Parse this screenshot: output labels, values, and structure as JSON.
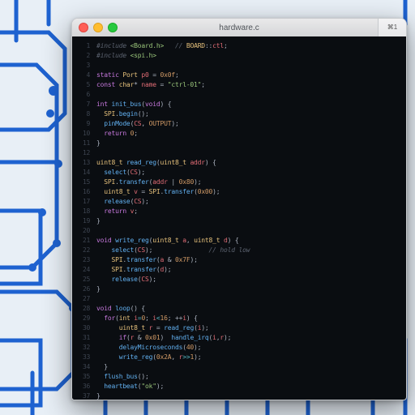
{
  "window": {
    "title": "hardware.c",
    "corner_tag": "⌘1"
  },
  "traffic": {
    "close": "close",
    "minimize": "minimize",
    "zoom": "zoom"
  },
  "editor": {
    "line_start": 1,
    "lines": [
      [
        [
          "c-c",
          "#include "
        ],
        [
          "c-s",
          "<Board.h>"
        ],
        [
          "c-p",
          "   "
        ],
        [
          "c-c",
          "// "
        ],
        [
          "c-f",
          "BOARD"
        ],
        [
          "c-p",
          "::"
        ],
        [
          "c-v",
          "ctl"
        ],
        [
          "c-p",
          ";"
        ]
      ],
      [
        [
          "c-c",
          "#include "
        ],
        [
          "c-s",
          "<spi.h>"
        ]
      ],
      [
        [
          "c-p",
          ""
        ]
      ],
      [
        [
          "c-k",
          "static "
        ],
        [
          "c-f",
          "Port"
        ],
        [
          "c-p",
          " "
        ],
        [
          "c-v",
          "p0"
        ],
        [
          "c-p",
          " = "
        ],
        [
          "c-n",
          "0x0f"
        ],
        [
          "c-p",
          ";"
        ]
      ],
      [
        [
          "c-k",
          "const "
        ],
        [
          "c-f",
          "char"
        ],
        [
          "c-p",
          "* "
        ],
        [
          "c-v",
          "name"
        ],
        [
          "c-p",
          " = "
        ],
        [
          "c-s",
          "\"ctrl-01\""
        ],
        [
          "c-p",
          ";"
        ]
      ],
      [
        [
          "c-p",
          ""
        ]
      ],
      [
        [
          "c-k",
          "int "
        ],
        [
          "c-b",
          "init_bus"
        ],
        [
          "c-p",
          "("
        ],
        [
          "c-k",
          "void"
        ],
        [
          "c-p",
          ") {"
        ]
      ],
      [
        [
          "c-p",
          "  "
        ],
        [
          "c-f",
          "SPI"
        ],
        [
          "c-p",
          "."
        ],
        [
          "c-b",
          "begin"
        ],
        [
          "c-p",
          "();"
        ]
      ],
      [
        [
          "c-p",
          "  "
        ],
        [
          "c-b",
          "pinMode"
        ],
        [
          "c-p",
          "("
        ],
        [
          "c-v",
          "CS"
        ],
        [
          "c-p",
          ", "
        ],
        [
          "c-n",
          "OUTPUT"
        ],
        [
          "c-p",
          ");"
        ]
      ],
      [
        [
          "c-p",
          "  "
        ],
        [
          "c-k",
          "return "
        ],
        [
          "c-n",
          "0"
        ],
        [
          "c-p",
          ";"
        ]
      ],
      [
        [
          "c-p",
          "}"
        ]
      ],
      [
        [
          "c-p",
          ""
        ]
      ],
      [
        [
          "c-f",
          "uint8_t "
        ],
        [
          "c-b",
          "read_reg"
        ],
        [
          "c-p",
          "("
        ],
        [
          "c-f",
          "uint8_t "
        ],
        [
          "c-v",
          "addr"
        ],
        [
          "c-p",
          ") {"
        ]
      ],
      [
        [
          "c-p",
          "  "
        ],
        [
          "c-b",
          "select"
        ],
        [
          "c-p",
          "("
        ],
        [
          "c-v",
          "CS"
        ],
        [
          "c-p",
          ");"
        ]
      ],
      [
        [
          "c-p",
          "  "
        ],
        [
          "c-f",
          "SPI"
        ],
        [
          "c-p",
          "."
        ],
        [
          "c-b",
          "transfer"
        ],
        [
          "c-p",
          "("
        ],
        [
          "c-v",
          "addr"
        ],
        [
          "c-p",
          " | "
        ],
        [
          "c-n",
          "0x80"
        ],
        [
          "c-p",
          ");"
        ]
      ],
      [
        [
          "c-p",
          "  "
        ],
        [
          "c-f",
          "uint8_t "
        ],
        [
          "c-v",
          "v"
        ],
        [
          "c-p",
          " = "
        ],
        [
          "c-f",
          "SPI"
        ],
        [
          "c-p",
          "."
        ],
        [
          "c-b",
          "transfer"
        ],
        [
          "c-p",
          "("
        ],
        [
          "c-n",
          "0x00"
        ],
        [
          "c-p",
          ");"
        ]
      ],
      [
        [
          "c-p",
          "  "
        ],
        [
          "c-b",
          "release"
        ],
        [
          "c-p",
          "("
        ],
        [
          "c-v",
          "CS"
        ],
        [
          "c-p",
          ");"
        ]
      ],
      [
        [
          "c-p",
          "  "
        ],
        [
          "c-k",
          "return "
        ],
        [
          "c-v",
          "v"
        ],
        [
          "c-p",
          ";"
        ]
      ],
      [
        [
          "c-p",
          "}"
        ]
      ],
      [
        [
          "c-p",
          ""
        ]
      ],
      [
        [
          "c-k",
          "void "
        ],
        [
          "c-b",
          "write_reg"
        ],
        [
          "c-p",
          "("
        ],
        [
          "c-f",
          "uint8_t "
        ],
        [
          "c-v",
          "a"
        ],
        [
          "c-p",
          ", "
        ],
        [
          "c-f",
          "uint8_t "
        ],
        [
          "c-v",
          "d"
        ],
        [
          "c-p",
          ") {"
        ]
      ],
      [
        [
          "c-p",
          "    "
        ],
        [
          "c-b",
          "select"
        ],
        [
          "c-p",
          "("
        ],
        [
          "c-v",
          "CS"
        ],
        [
          "c-p",
          ");               "
        ],
        [
          "c-c",
          "// hold low"
        ]
      ],
      [
        [
          "c-p",
          "    "
        ],
        [
          "c-f",
          "SPI"
        ],
        [
          "c-p",
          "."
        ],
        [
          "c-b",
          "transfer"
        ],
        [
          "c-p",
          "("
        ],
        [
          "c-v",
          "a"
        ],
        [
          "c-p",
          " & "
        ],
        [
          "c-n",
          "0x7F"
        ],
        [
          "c-p",
          ");"
        ]
      ],
      [
        [
          "c-p",
          "    "
        ],
        [
          "c-f",
          "SPI"
        ],
        [
          "c-p",
          "."
        ],
        [
          "c-b",
          "transfer"
        ],
        [
          "c-p",
          "("
        ],
        [
          "c-v",
          "d"
        ],
        [
          "c-p",
          ");"
        ]
      ],
      [
        [
          "c-p",
          "    "
        ],
        [
          "c-b",
          "release"
        ],
        [
          "c-p",
          "("
        ],
        [
          "c-v",
          "CS"
        ],
        [
          "c-p",
          ");"
        ]
      ],
      [
        [
          "c-p",
          "}"
        ]
      ],
      [
        [
          "c-p",
          ""
        ]
      ],
      [
        [
          "c-k",
          "void "
        ],
        [
          "c-b",
          "loop"
        ],
        [
          "c-p",
          "() {"
        ]
      ],
      [
        [
          "c-p",
          "  "
        ],
        [
          "c-k",
          "for"
        ],
        [
          "c-p",
          "("
        ],
        [
          "c-f",
          "int "
        ],
        [
          "c-v",
          "i"
        ],
        [
          "c-o",
          "="
        ],
        [
          "c-n",
          "0"
        ],
        [
          "c-p",
          "; "
        ],
        [
          "c-v",
          "i"
        ],
        [
          "c-o",
          "<"
        ],
        [
          "c-n",
          "16"
        ],
        [
          "c-p",
          "; ++"
        ],
        [
          "c-v",
          "i"
        ],
        [
          "c-p",
          ") {"
        ]
      ],
      [
        [
          "c-p",
          "      "
        ],
        [
          "c-f",
          "uint8_t "
        ],
        [
          "c-v",
          "r"
        ],
        [
          "c-p",
          " = "
        ],
        [
          "c-b",
          "read_reg"
        ],
        [
          "c-p",
          "("
        ],
        [
          "c-v",
          "i"
        ],
        [
          "c-p",
          ");"
        ]
      ],
      [
        [
          "c-p",
          "      "
        ],
        [
          "c-k",
          "if"
        ],
        [
          "c-p",
          "("
        ],
        [
          "c-v",
          "r"
        ],
        [
          "c-p",
          " & "
        ],
        [
          "c-n",
          "0x01"
        ],
        [
          "c-p",
          ")  "
        ],
        [
          "c-b",
          "handle_irq"
        ],
        [
          "c-p",
          "("
        ],
        [
          "c-v",
          "i"
        ],
        [
          "c-p",
          ","
        ],
        [
          "c-v",
          "r"
        ],
        [
          "c-p",
          ");"
        ]
      ],
      [
        [
          "c-p",
          "      "
        ],
        [
          "c-b",
          "delayMicroseconds"
        ],
        [
          "c-p",
          "("
        ],
        [
          "c-n",
          "40"
        ],
        [
          "c-p",
          ");"
        ]
      ],
      [
        [
          "c-p",
          "      "
        ],
        [
          "c-b",
          "write_reg"
        ],
        [
          "c-p",
          "("
        ],
        [
          "c-n",
          "0x2A"
        ],
        [
          "c-p",
          ", "
        ],
        [
          "c-v",
          "r"
        ],
        [
          "c-o",
          ">>"
        ],
        [
          "c-n",
          "1"
        ],
        [
          "c-p",
          ");"
        ]
      ],
      [
        [
          "c-p",
          "  }"
        ]
      ],
      [
        [
          "c-p",
          "  "
        ],
        [
          "c-b",
          "flush_bus"
        ],
        [
          "c-p",
          "();"
        ]
      ],
      [
        [
          "c-p",
          "  "
        ],
        [
          "c-b",
          "heartbeat"
        ],
        [
          "c-p",
          "("
        ],
        [
          "c-s",
          "\"ok\""
        ],
        [
          "c-p",
          ");"
        ]
      ],
      [
        [
          "c-p",
          "}"
        ]
      ]
    ]
  }
}
